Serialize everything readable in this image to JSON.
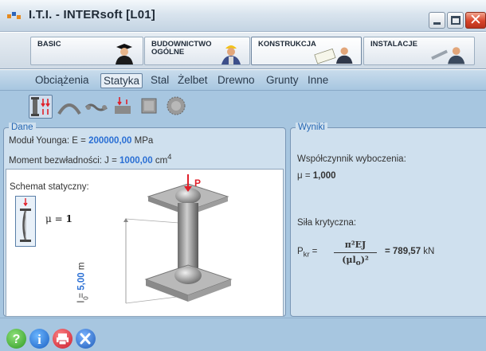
{
  "window": {
    "title": "I.T.I. - INTERsoft [L01]",
    "close_glyph": "✕"
  },
  "modules": [
    {
      "label": "BASIC",
      "icon": "graduate-icon",
      "active": false
    },
    {
      "label": "BUDOWNICTWO OGÓLNE",
      "line1": "BUDOWNICTWO",
      "line2": "OGÓLNE",
      "icon": "builder-icon",
      "active": false
    },
    {
      "label": "KONSTRUKCJA",
      "icon": "engineer-drawing-icon",
      "active": true
    },
    {
      "label": "INSTALACJE",
      "icon": "plumber-icon",
      "active": false
    }
  ],
  "subtabs": [
    "Obciążenia",
    "Statyka",
    "Stal",
    "Żelbet",
    "Drewno",
    "Grunty",
    "Inne"
  ],
  "active_subtab": "Statyka",
  "tools": [
    "column-buckling-icon",
    "arch-icon",
    "beam-spring-icon",
    "frame-load-icon",
    "plate-icon",
    "circular-plate-icon"
  ],
  "dane": {
    "legend": "Dane",
    "youngs_label": "Moduł Younga: E = ",
    "youngs_value": "200000,00",
    "youngs_unit": "MPa",
    "inertia_label": "Moment bezwładności: J = ",
    "inertia_value": "1000,00",
    "inertia_unit": "cm",
    "inertia_exp": "4",
    "schema_title": "Schemat statyczny:",
    "mu_symbol": "μ = ",
    "mu_value": "1",
    "load_label": "P",
    "length_label": "l = ",
    "length_value": "5,00",
    "length_unit": "m",
    "length_sub": "0"
  },
  "wyniki": {
    "legend": "Wyniki",
    "buckling_label": "Współczynnik wyboczenia:",
    "mu_text": "μ = ",
    "mu_value": "1,000",
    "critical_label": "Siła krytyczna:",
    "pkr_symbol": "P",
    "pkr_sub": "kr",
    "eq": "=",
    "numerator": "π²EJ",
    "denominator": "(μl",
    "denominator_sub": "o",
    "denominator_end": ")²",
    "result_value": "= 789,57",
    "result_unit": "kN"
  },
  "statusbar": [
    "help-icon",
    "info-icon",
    "print-icon",
    "settings-icon"
  ],
  "colors": {
    "accent_blue": "#2a6fd4",
    "panel_bg": "#cfe0ee",
    "main_bg": "#a7c6e0",
    "close_red": "#d8442a",
    "load_red": "#e0202a"
  }
}
